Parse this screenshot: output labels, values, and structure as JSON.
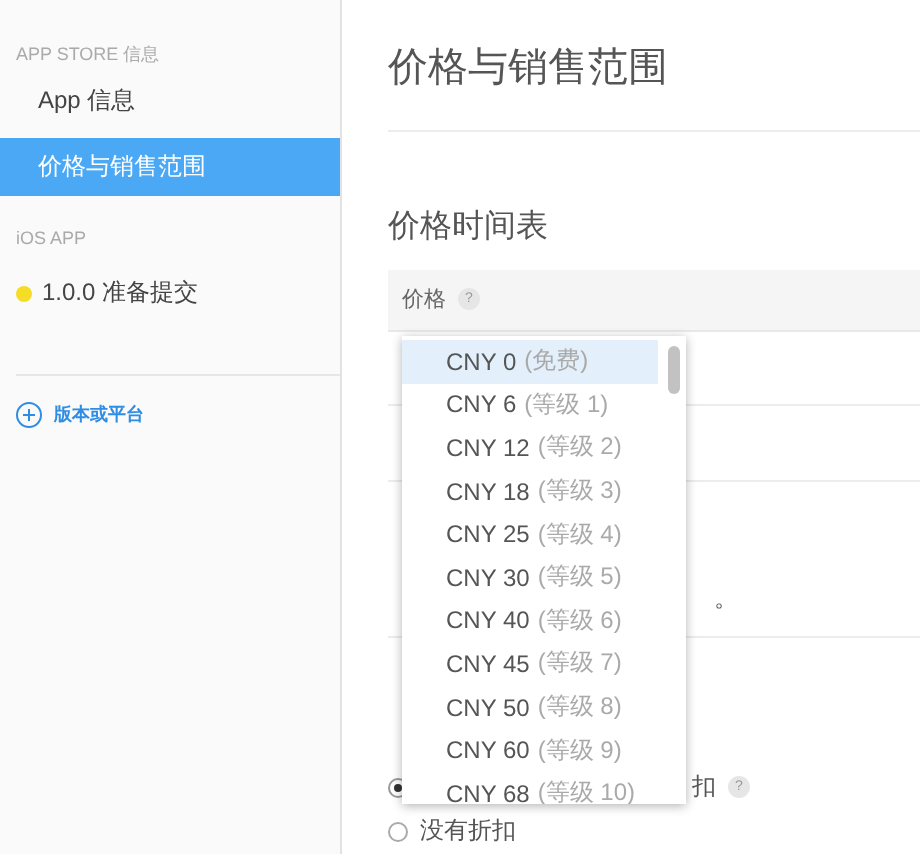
{
  "sidebar": {
    "sections": [
      {
        "heading": "APP STORE 信息",
        "items": [
          {
            "kind": "link",
            "label": "App 信息",
            "selected": false
          },
          {
            "kind": "link",
            "label": "价格与销售范围",
            "selected": true
          }
        ]
      },
      {
        "heading": "iOS APP",
        "items": [
          {
            "kind": "status",
            "label": "1.0.0 准备提交",
            "selected": false,
            "color": "#f5dc26"
          }
        ]
      }
    ],
    "add_button": "版本或平台"
  },
  "main": {
    "title": "价格与销售范围",
    "schedule": {
      "heading": "价格时间表",
      "column": "价格",
      "help": "?"
    },
    "availability": {
      "text_right": "。"
    },
    "discount": {
      "options": [
        {
          "label": "扣",
          "help": "?",
          "selected": true
        },
        {
          "label": "没有折扣",
          "selected": false
        }
      ]
    },
    "dropdown": {
      "options": [
        {
          "price": "CNY 0",
          "tier": "(免费)",
          "selected": true
        },
        {
          "price": "CNY 6",
          "tier": "(等级 1)",
          "selected": false
        },
        {
          "price": "CNY 12",
          "tier": "(等级 2)",
          "selected": false
        },
        {
          "price": "CNY 18",
          "tier": "(等级 3)",
          "selected": false
        },
        {
          "price": "CNY 25",
          "tier": "(等级 4)",
          "selected": false
        },
        {
          "price": "CNY 30",
          "tier": "(等级 5)",
          "selected": false
        },
        {
          "price": "CNY 40",
          "tier": "(等级 6)",
          "selected": false
        },
        {
          "price": "CNY 45",
          "tier": "(等级 7)",
          "selected": false
        },
        {
          "price": "CNY 50",
          "tier": "(等级 8)",
          "selected": false
        },
        {
          "price": "CNY 60",
          "tier": "(等级 9)",
          "selected": false
        },
        {
          "price": "CNY 68",
          "tier": "(等级 10)",
          "selected": false
        }
      ]
    }
  }
}
